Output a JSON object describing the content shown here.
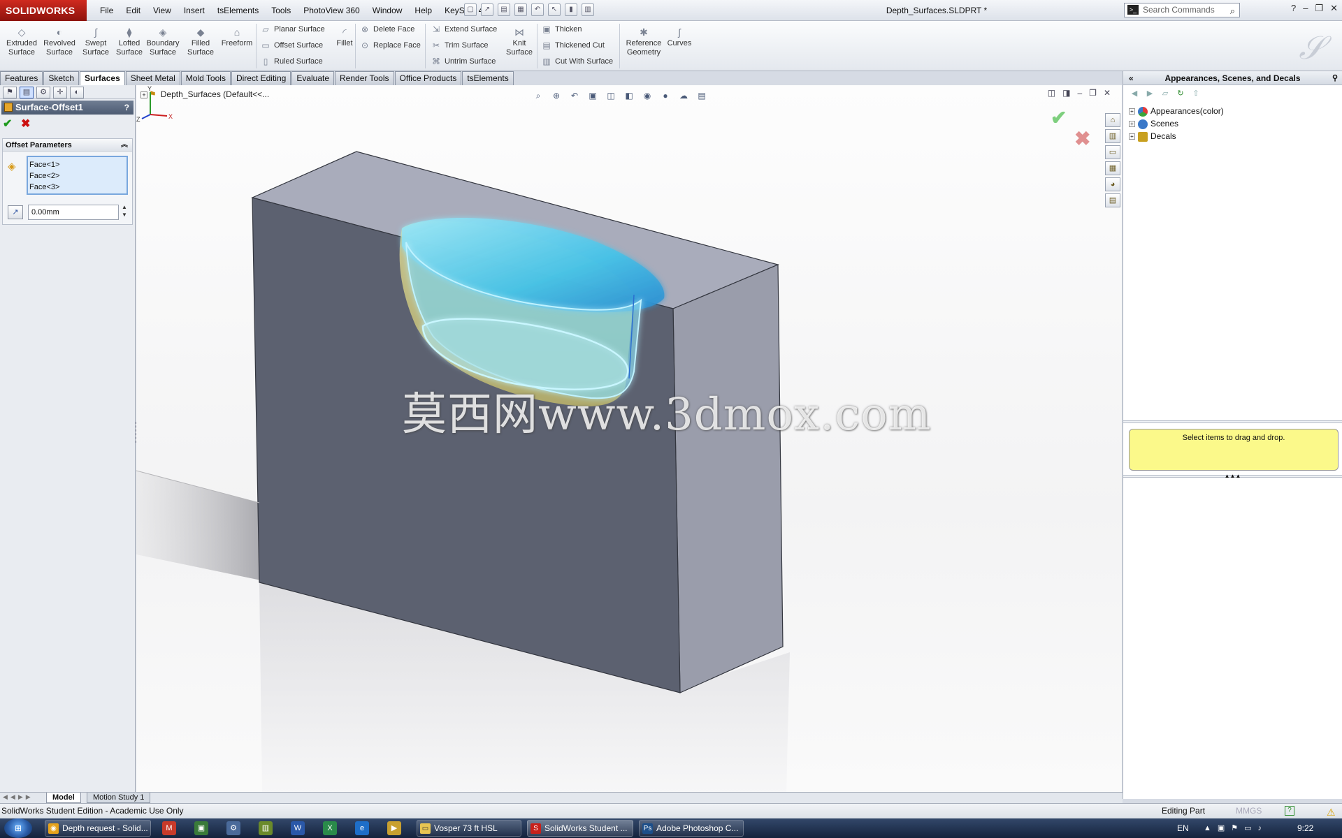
{
  "titlebar": {
    "logo": "SOLIDWORKS",
    "menu": [
      "File",
      "Edit",
      "View",
      "Insert",
      "tsElements",
      "Tools",
      "PhotoView 360",
      "Window",
      "Help",
      "KeyShot 4"
    ],
    "document_title": "Depth_Surfaces.SLDPRT *",
    "search_placeholder": "Search Commands"
  },
  "command_manager": {
    "big_buttons": [
      {
        "label": "Extruded Surface",
        "icon": "extruded-surface-icon"
      },
      {
        "label": "Revolved Surface",
        "icon": "revolved-surface-icon"
      },
      {
        "label": "Swept Surface",
        "icon": "swept-surface-icon"
      },
      {
        "label": "Lofted Surface",
        "icon": "lofted-surface-icon"
      },
      {
        "label": "Boundary Surface",
        "icon": "boundary-surface-icon"
      },
      {
        "label": "Filled Surface",
        "icon": "filled-surface-icon"
      },
      {
        "label": "Freeform",
        "icon": "freeform-icon"
      }
    ],
    "col1": [
      "Planar Surface",
      "Offset Surface",
      "Ruled Surface"
    ],
    "fillet": "Fillet",
    "col2": [
      "Delete Face",
      "Replace Face"
    ],
    "col3": [
      "Extend Surface",
      "Trim Surface",
      "Untrim Surface"
    ],
    "knit": "Knit Surface",
    "col4": [
      "Thicken",
      "Thickened Cut",
      "Cut With Surface"
    ],
    "reference_geometry": "Reference Geometry",
    "curves": "Curves"
  },
  "tabs": [
    "Features",
    "Sketch",
    "Surfaces",
    "Sheet Metal",
    "Mold Tools",
    "Direct Editing",
    "Evaluate",
    "Render Tools",
    "Office Products",
    "tsElements"
  ],
  "active_tab": "Surfaces",
  "property_manager": {
    "title": "Surface-Offset1",
    "help": "?",
    "group_title": "Offset Parameters",
    "faces": [
      "Face<1>",
      "Face<2>",
      "Face<3>"
    ],
    "distance": "0.00mm"
  },
  "viewport": {
    "tree_root": "Depth_Surfaces  (Default<<...",
    "watermark": "莫西网www.3dmox.com",
    "triad": {
      "x": "X",
      "y": "Y",
      "z": "Z"
    }
  },
  "task_pane": {
    "title": "Appearances, Scenes, and Decals",
    "tree": [
      {
        "label": "Appearances(color)",
        "color": "#3aa53a"
      },
      {
        "label": "Scenes",
        "color": "#3a78c8"
      },
      {
        "label": "Decals",
        "color": "#c8a020"
      }
    ],
    "drag_hint": "Select items to drag and drop."
  },
  "bottom_tabs": [
    "Model",
    "Motion Study 1"
  ],
  "status": {
    "left": "SolidWorks Student Edition - Academic Use Only",
    "mode": "Editing Part",
    "units": "MMGS"
  },
  "taskbar": {
    "buttons": [
      {
        "label": "Depth request - Solid...",
        "icon": "chrome-icon",
        "color": "#e7a31c"
      },
      {
        "label": "Vosper 73 ft HSL",
        "icon": "folder-icon",
        "color": "#e8c552"
      },
      {
        "label": "SolidWorks Student ...",
        "icon": "solidworks-icon",
        "color": "#c8201a"
      },
      {
        "label": "Adobe Photoshop C...",
        "icon": "photoshop-icon",
        "color": "#1d4f8a"
      }
    ],
    "language": "EN",
    "clock": "9:22"
  },
  "colors": {
    "accent": "#3a63b5",
    "block_front": "#5c6170",
    "block_top": "#a7aab9",
    "block_side": "#9a9dab",
    "cavity_cyan": "#3fc6e6",
    "offset_yellow": "#d9d383"
  }
}
